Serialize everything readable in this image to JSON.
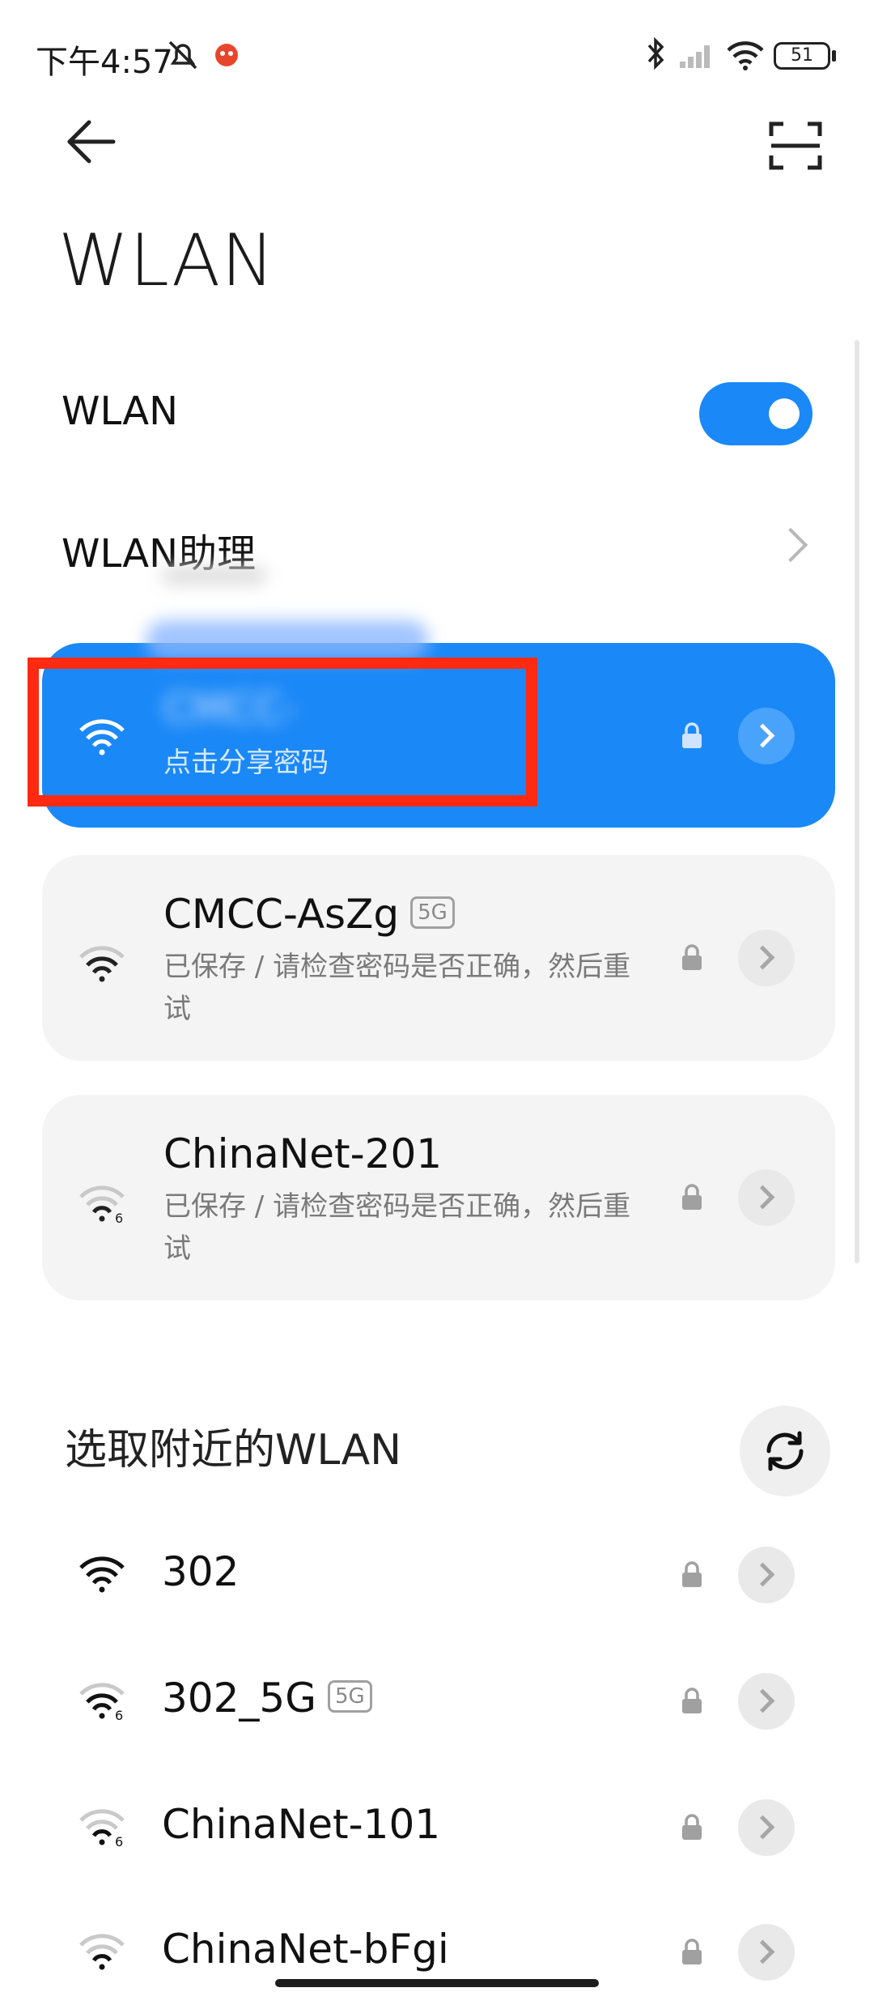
{
  "status_bar": {
    "time": "下午4:57",
    "battery": "51"
  },
  "header": {
    "title": "WLAN"
  },
  "wlan_row": {
    "label": "WLAN",
    "enabled": true
  },
  "assistant_row": {
    "label": "WLAN助理"
  },
  "connected": {
    "name": "CMCC-",
    "subtitle": "点击分享密码"
  },
  "saved_networks": [
    {
      "name": "CMCC-AsZg",
      "band": "5G",
      "status": "已保存 / 请检查密码是否正确，然后重试"
    },
    {
      "name": "ChinaNet-201",
      "band": "",
      "status": "已保存 / 请检查密码是否正确，然后重试"
    }
  ],
  "nearby": {
    "title": "选取附近的WLAN",
    "networks": [
      {
        "name": "302",
        "band": ""
      },
      {
        "name": "302_5G",
        "band": "5G"
      },
      {
        "name": "ChinaNet-101",
        "band": ""
      },
      {
        "name": "ChinaNet-bFgi",
        "band": ""
      }
    ]
  },
  "colors": {
    "accent": "#1a88f7",
    "card_bg": "#f4f4f4",
    "highlight": "#ff2a12"
  }
}
